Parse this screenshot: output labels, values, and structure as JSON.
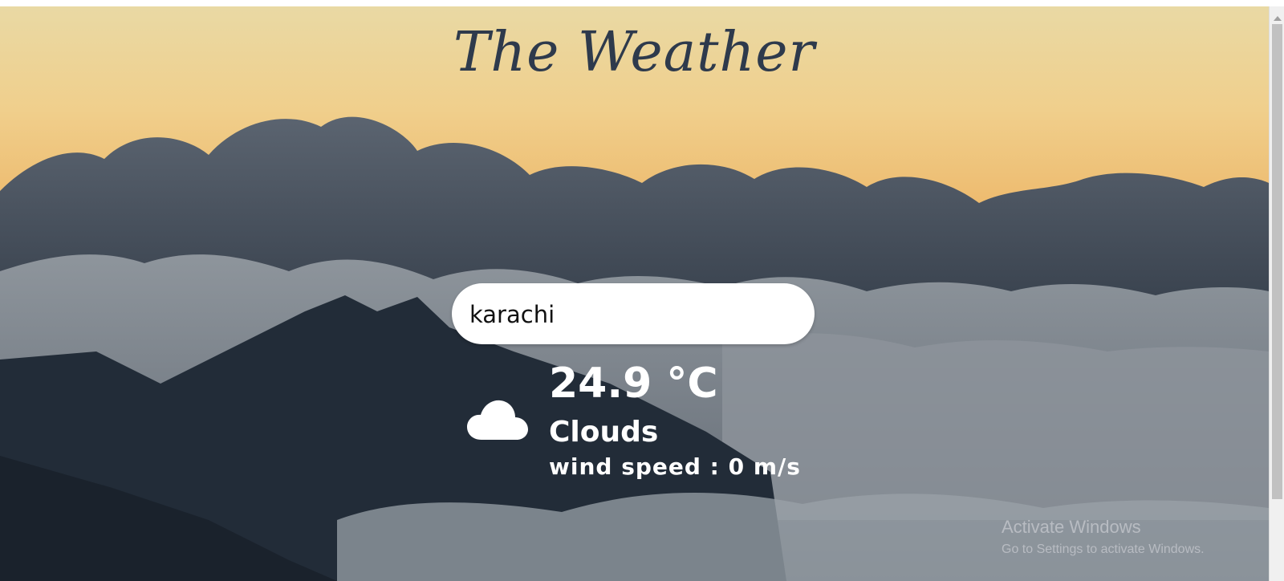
{
  "page": {
    "title": "The Weather"
  },
  "search": {
    "value": "karachi"
  },
  "weather": {
    "temperature": "24.9 °C",
    "condition": "Clouds",
    "wind": "wind speed : 0 m/s",
    "icon": "cloud-icon"
  },
  "watermark": {
    "heading": "Activate Windows",
    "subtext": "Go to Settings to activate Windows."
  },
  "colors": {
    "title": "#2e3a4c",
    "sky_top": "#e9d9a4",
    "sky_mid": "#edb96c",
    "cloud_dark": "#3d4753",
    "text_light": "#ffffff"
  }
}
